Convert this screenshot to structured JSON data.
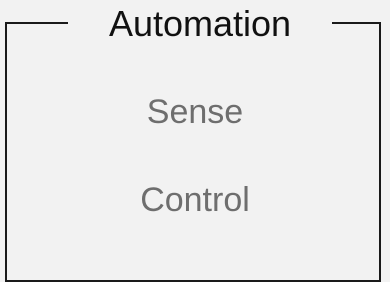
{
  "group": {
    "title": "Automation",
    "items": [
      {
        "label": "Sense"
      },
      {
        "label": "Control"
      }
    ]
  },
  "colors": {
    "background": "#f2f2f2",
    "border": "#1a1a1a",
    "title_text": "#111111",
    "item_text": "#6e6e6e"
  }
}
